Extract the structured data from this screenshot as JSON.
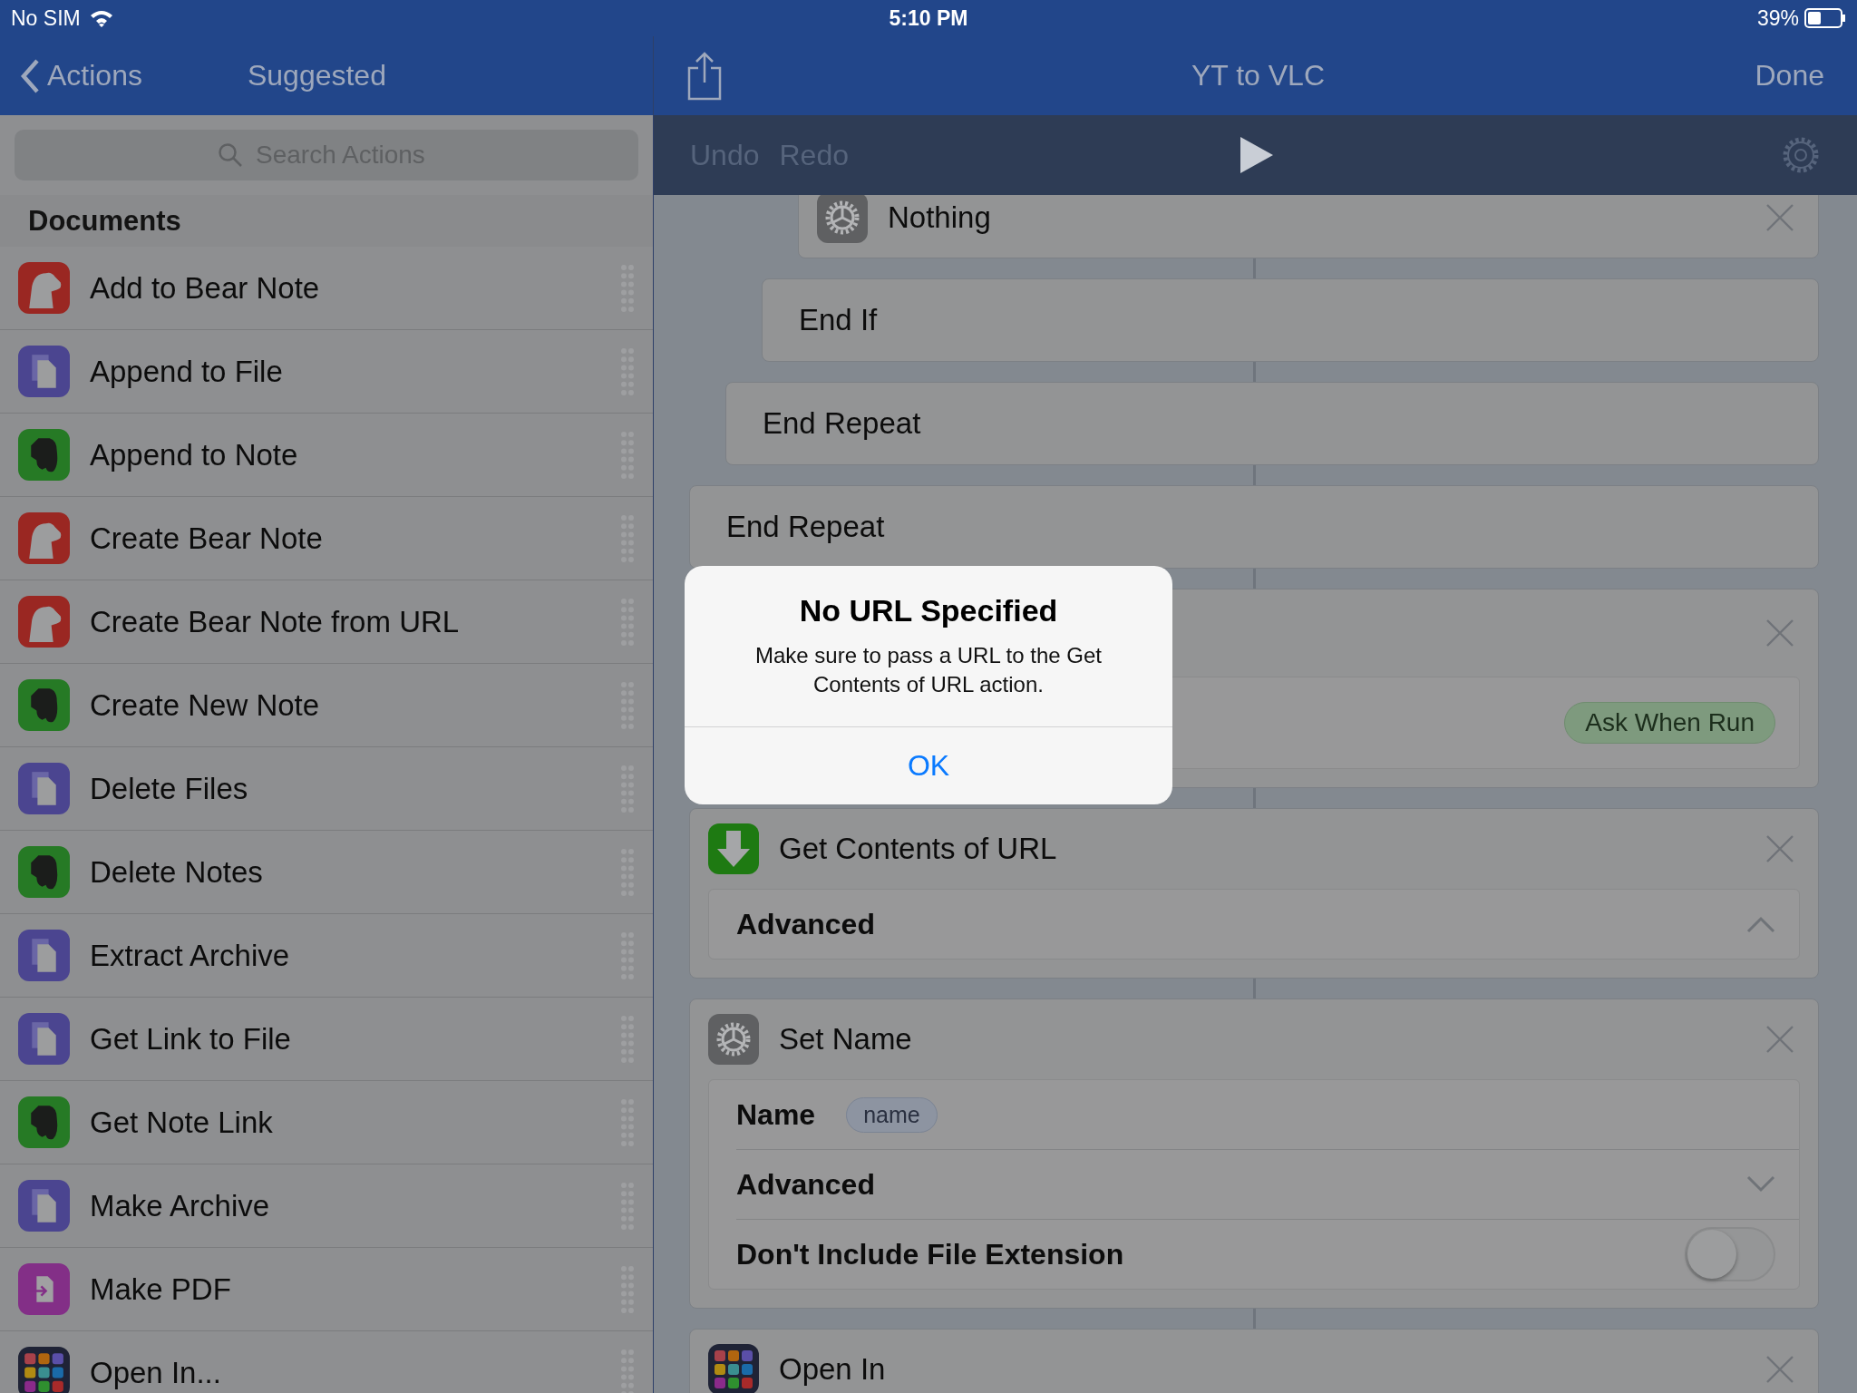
{
  "status_bar": {
    "carrier": "No SIM",
    "time": "5:10 PM",
    "battery": "39%"
  },
  "sidebar": {
    "back_label": "Actions",
    "title": "Suggested",
    "search": {
      "placeholder": "Search Actions"
    },
    "section": "Documents",
    "items": [
      {
        "label": "Add to Bear Note",
        "kind": "bear"
      },
      {
        "label": "Append to File",
        "kind": "file"
      },
      {
        "label": "Append to Note",
        "kind": "evernote"
      },
      {
        "label": "Create Bear Note",
        "kind": "bear"
      },
      {
        "label": "Create Bear Note from URL",
        "kind": "bear"
      },
      {
        "label": "Create New Note",
        "kind": "evernote"
      },
      {
        "label": "Delete Files",
        "kind": "file"
      },
      {
        "label": "Delete Notes",
        "kind": "evernote"
      },
      {
        "label": "Extract Archive",
        "kind": "file"
      },
      {
        "label": "Get Link to File",
        "kind": "file"
      },
      {
        "label": "Get Note Link",
        "kind": "evernote"
      },
      {
        "label": "Make Archive",
        "kind": "file"
      },
      {
        "label": "Make PDF",
        "kind": "pdf"
      },
      {
        "label": "Open In...",
        "kind": "apps"
      }
    ]
  },
  "editor": {
    "title": "YT to VLC",
    "done": "Done",
    "undo": "Undo",
    "redo": "Redo",
    "actions": [
      {
        "kind": "group",
        "children": [
          {
            "kind": "group",
            "children": [
              {
                "kind": "group",
                "children": [
                  {
                    "kind": "action",
                    "icon": {
                      "kind": "gear"
                    },
                    "title": "Nothing"
                  }
                ]
              },
              {
                "kind": "end",
                "title": "End If"
              }
            ]
          },
          {
            "kind": "end",
            "title": "End Repeat"
          }
        ]
      },
      {
        "kind": "end",
        "title": "End Repeat"
      },
      {
        "kind": "action",
        "params": [
          {
            "kind": "ask",
            "value": "Ask When Run"
          }
        ]
      },
      {
        "kind": "action",
        "icon": {
          "kind": "download"
        },
        "title": "Get Contents of URL",
        "params": [
          {
            "kind": "disclosure",
            "label": "Advanced",
            "expanded": true
          }
        ]
      },
      {
        "kind": "action",
        "icon": {
          "kind": "gear"
        },
        "title": "Set Name",
        "params": [
          {
            "kind": "variable",
            "label": "Name",
            "token": "name"
          },
          {
            "kind": "disclosure",
            "label": "Advanced",
            "expanded": false
          },
          {
            "kind": "switch",
            "label": "Don't Include File Extension",
            "on": false
          }
        ]
      },
      {
        "kind": "action",
        "icon": {
          "kind": "apps"
        },
        "title": "Open In"
      }
    ]
  },
  "alert": {
    "title": "No URL Specified",
    "message": "Make sure to pass a URL to the Get Contents of URL action.",
    "button": "OK"
  }
}
